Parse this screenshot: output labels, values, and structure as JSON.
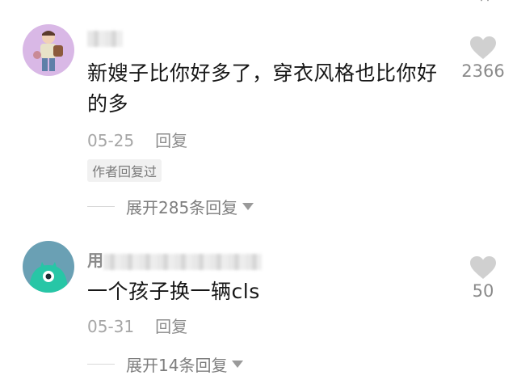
{
  "comments": [
    {
      "username_visible": "",
      "text": "新嫂子比你好多了，穿衣风格也比你好的多",
      "date": "05-25",
      "reply_label": "回复",
      "author_badge": "作者回复过",
      "expand_label": "展开285条回复",
      "like_count": "2366"
    },
    {
      "username_visible": "用",
      "text": "一个孩子换一辆cls",
      "date": "05-31",
      "reply_label": "回复",
      "expand_label": "展开14条回复",
      "like_count": "50"
    }
  ],
  "colors": {
    "avatar1_bg": "#d9b8e6",
    "avatar2_bg": "#6aa0b4",
    "avatar2_monster": "#27c6a6",
    "heart": "#d0d0d0"
  },
  "icons": {
    "like": "heart-icon",
    "expand": "caret-down-icon"
  }
}
